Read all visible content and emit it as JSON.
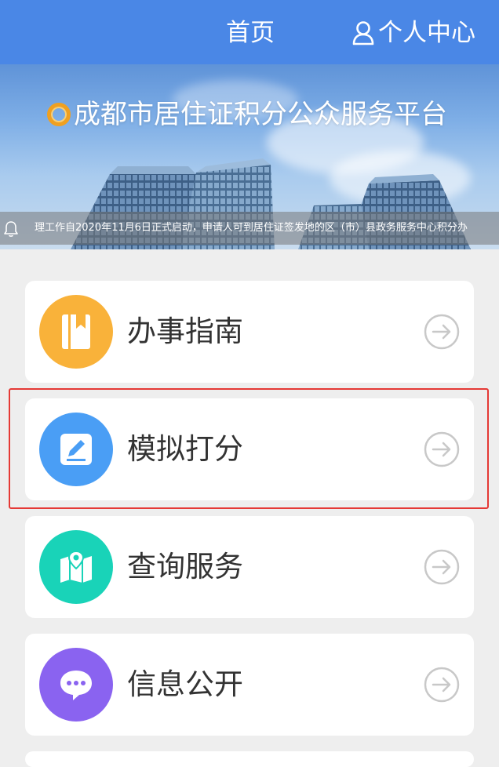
{
  "header": {
    "home_label": "首页",
    "user_center_label": "个人中心"
  },
  "banner": {
    "title": "成都市居住证积分公众服务平台",
    "notice": "理工作自2020年11月6日正式启动，申请人可到居住证签发地的区（市）县政务服务中心积分办"
  },
  "menu": [
    {
      "label": "办事指南",
      "icon": "book-icon",
      "color": "#f9b23a"
    },
    {
      "label": "模拟打分",
      "icon": "edit-icon",
      "color": "#4a9ef5"
    },
    {
      "label": "查询服务",
      "icon": "map-icon",
      "color": "#19d3b8"
    },
    {
      "label": "信息公开",
      "icon": "chat-icon",
      "color": "#8a63f0"
    }
  ],
  "highlighted_item": "模拟打分"
}
